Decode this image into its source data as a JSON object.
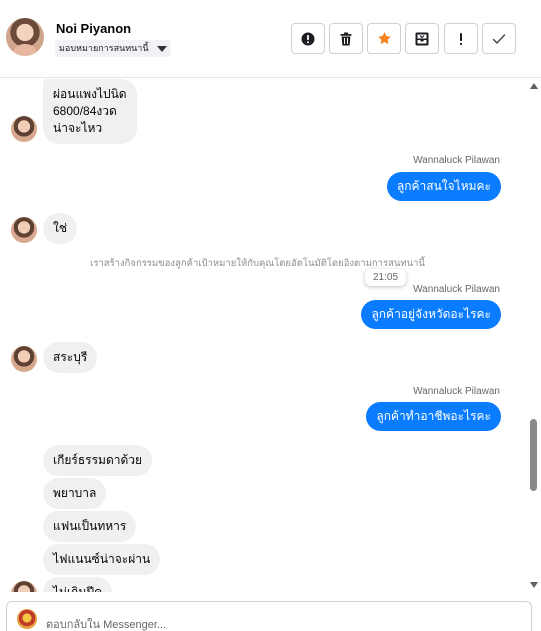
{
  "header": {
    "contact_name": "Noi Piyanon",
    "assign_label": "มอบหมายการสนทนานี้",
    "actions": [
      {
        "name": "report-button",
        "icon": "alert-circle-icon"
      },
      {
        "name": "delete-button",
        "icon": "trash-icon"
      },
      {
        "name": "star-button",
        "icon": "star-icon",
        "color": "#f5821f"
      },
      {
        "name": "archive-button",
        "icon": "inbox-tray-icon"
      },
      {
        "name": "mark-important-button",
        "icon": "exclamation-icon"
      },
      {
        "name": "mark-done-button",
        "icon": "check-icon"
      }
    ]
  },
  "thread": {
    "msg_1_lines": [
      "ผ่อนแพงไปนิด",
      "6800/84งวด",
      "น่าจะไหว"
    ],
    "sender_1": "Wannaluck Pilawan",
    "out_1": "ลูกค้าสนใจไหมคะ",
    "in_2": "ใช่",
    "system_note": "เราสร้างกิจกรรมของลูกค้าเป้าหมายให้กับคุณโดยอัตโนมัติโดยอิงตามการสนทนานี้",
    "time_tooltip": "21:05",
    "sender_2": "Wannaluck Pilawan",
    "out_2": "ลูกค้าอยู่จังหวัดอะไรคะ",
    "in_3": "สระบุรี",
    "sender_3": "Wannaluck Pilawan",
    "out_3": "ลูกค้าทำอาชีพอะไรคะ",
    "in_4": "เกียร์ธรรมดาด้วย",
    "in_5": "พยาบาล",
    "in_6": "แฟนเป็นทหาร",
    "in_7": "ไฟแนนซ์น่าจะผ่าน",
    "in_8": "ไม่เกินปีค"
  },
  "colors": {
    "outgoing_bubble": "#0a7cff",
    "incoming_bubble": "#f0f0f0",
    "star_accent": "#f5821f"
  },
  "reply": {
    "placeholder": "ตอบกลับใน Messenger..."
  }
}
